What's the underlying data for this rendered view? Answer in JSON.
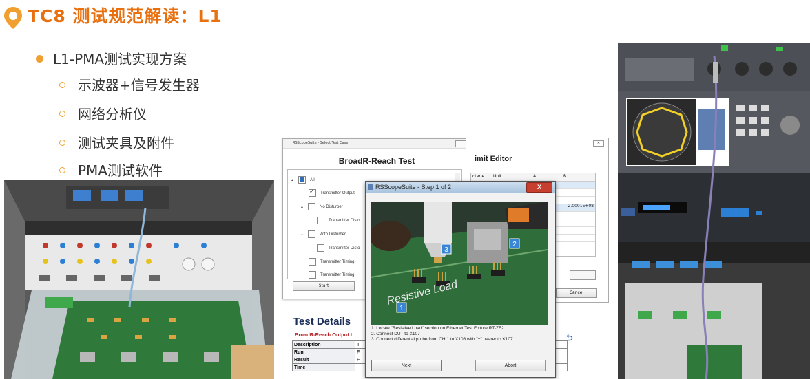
{
  "slide": {
    "title": "TC8 测试规范解读：L1",
    "bullet_main": "L1-PMA测试实现方案",
    "sub_bullets": [
      "示波器+信号发生器",
      "网络分析仪",
      "测试夹具及附件",
      "PMA测试软件"
    ]
  },
  "test_case_window": {
    "title": "RSScopeSuite - Select Test Case",
    "heading": "BroadR-Reach Test",
    "items": [
      "All",
      "Transmitter Output",
      "No Disturber",
      "Transmitter Disto",
      "With Disturber",
      "Transmitter Disto",
      "Transmitter Timing",
      "Transmitter Timing"
    ],
    "start": "Start"
  },
  "limit_window": {
    "heading": "imit Editor",
    "columns": [
      "cterle",
      "Unit",
      "A",
      "B"
    ],
    "value": "2.0001E+08",
    "cancel": "Cancel"
  },
  "step_dialog": {
    "title": "RSScopeSuite - Step 1 of 2",
    "close": "X",
    "steps": [
      "1. Locate \"Resistive Load\" section on Ethernet Test Fixture RT-ZF2",
      "2. Connect DUT to X107",
      "3. Connect differential probe from CH 1 to X108 with \"+\" nearer to X107"
    ],
    "next": "Next",
    "abort": "Abort",
    "markers": [
      "1",
      "2",
      "3"
    ],
    "board_text": "Resistive Load"
  },
  "test_details": {
    "heading": "Test Details",
    "subtitle": "BroadR-Reach Output I",
    "rows": [
      {
        "key": "Description",
        "value": "T"
      },
      {
        "key": "Run",
        "value": "F"
      },
      {
        "key": "Result",
        "value": "F"
      },
      {
        "key": "Time",
        "value": ""
      }
    ]
  },
  "colors": {
    "accent": "#e8700f",
    "bullet": "#f0a030",
    "heading_blue": "#1c2e5a"
  }
}
